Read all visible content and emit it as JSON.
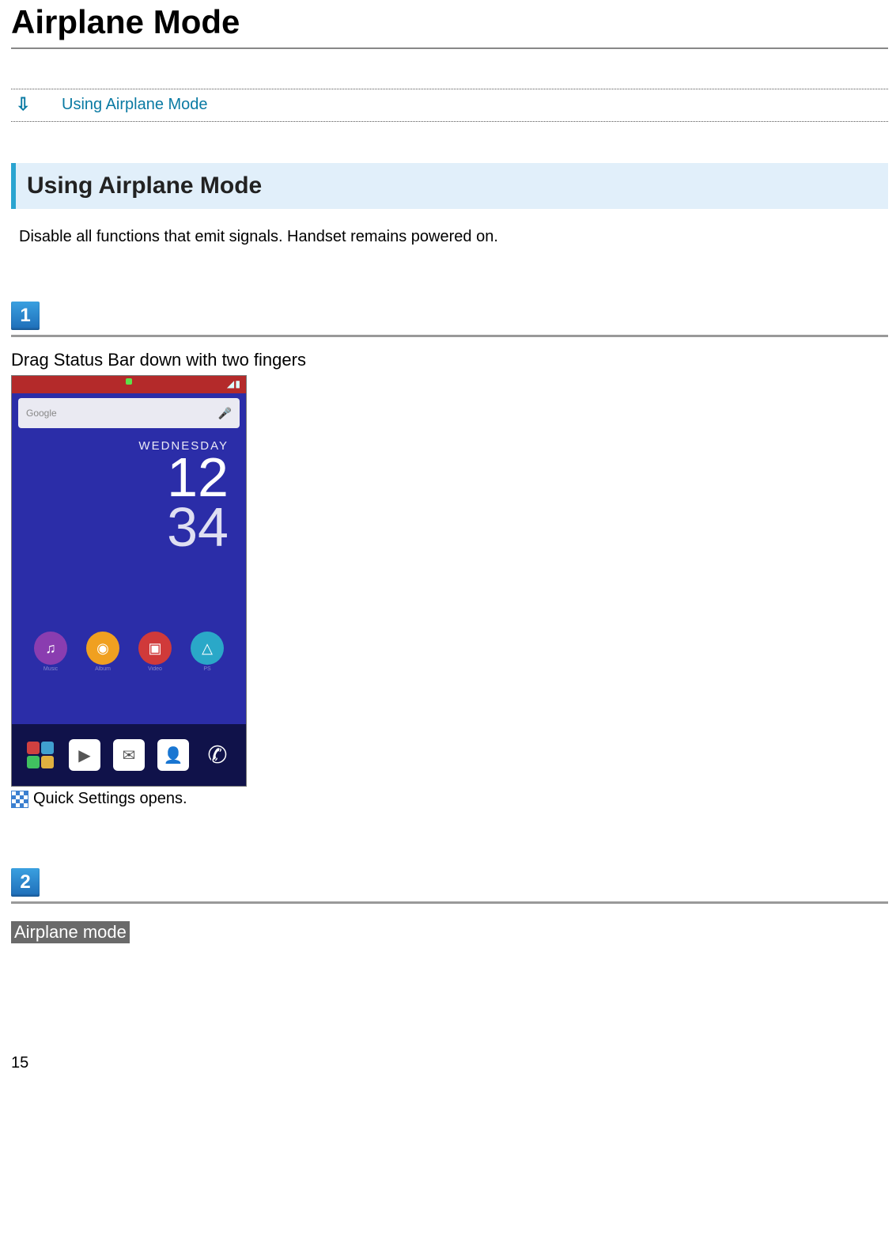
{
  "page": {
    "title": "Airplane Mode",
    "number": "15"
  },
  "toc": {
    "link_text": "Using Airplane Mode"
  },
  "section": {
    "heading": "Using Airplane Mode",
    "description": "Disable all functions that emit signals. Handset remains powered on."
  },
  "steps": {
    "s1": {
      "num": "1",
      "title": "Drag Status Bar down with two fingers",
      "result": "Quick Settings opens."
    },
    "s2": {
      "num": "2",
      "chip": "Airplane mode"
    }
  },
  "phone": {
    "search_placeholder": "Google",
    "day_label": "WEDNESDAY",
    "hours": "12",
    "minutes": "34",
    "apps": {
      "music": "Music",
      "album": "Album",
      "video": "Video",
      "ps": "PS"
    }
  }
}
